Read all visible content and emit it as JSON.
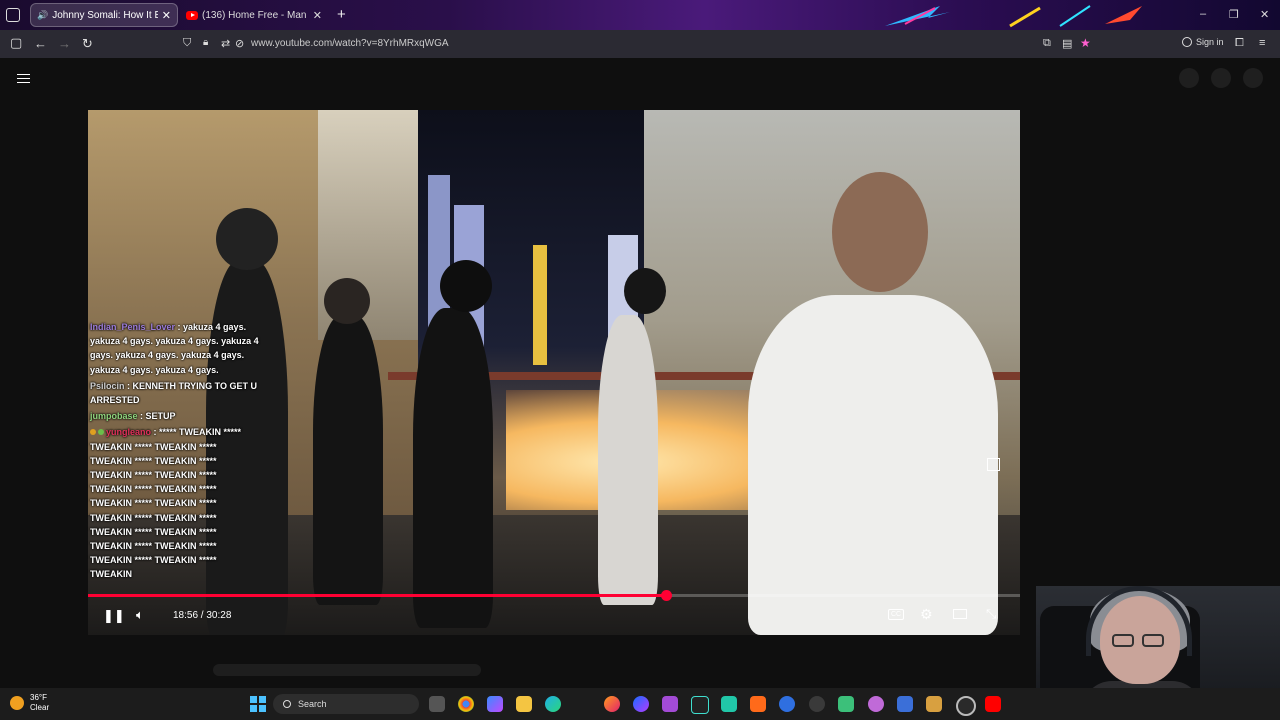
{
  "browser": {
    "tabs": [
      {
        "title": "Johnny Somali: How It Ende",
        "active": true,
        "audio": true
      },
      {
        "title": "(136) Home Free - Man of Con",
        "active": false,
        "audio": false
      }
    ],
    "new_tab": "+",
    "url": "www.youtube.com/watch?v=8YrhMRxqWGA",
    "sign_in": "Sign in",
    "window_controls": [
      "–",
      "❐",
      "✕"
    ],
    "nav_icons": [
      "sidebar-icon",
      "back-icon",
      "forward-icon",
      "reload-icon"
    ]
  },
  "youtube": {
    "menu_icon": "hamburger-icon"
  },
  "video": {
    "chat": [
      {
        "user": "Indian_Penis_Lover",
        "color": "#9b7bd9",
        "text": " : yakuza 4 gays. yakuza 4 gays. yakuza 4 gays. yakuza 4 gays. yakuza 4 gays. yakuza 4 gays. yakuza 4 gays. yakuza 4 gays."
      },
      {
        "user": "Psilocin",
        "color": "#cfcfcf",
        "text": " : KENNETH TRYING TO GET U ARRESTED"
      },
      {
        "user": "jumpobase",
        "color": "#8fd47d",
        "text": " : SETUP"
      },
      {
        "user": "yungleano",
        "color": "#e0305a",
        "text": " : ***** TWEAKIN ***** TWEAKIN ***** TWEAKIN ***** TWEAKIN ***** TWEAKIN ***** TWEAKIN ***** TWEAKIN ***** TWEAKIN ***** TWEAKIN ***** TWEAKIN ***** TWEAKIN ***** TWEAKIN ***** TWEAKIN ***** TWEAKIN ***** TWEAKIN ***** TWEAKIN ***** TWEAKIN ***** TWEAKIN ***** TWEAKIN ***** TWEAKIN"
      }
    ],
    "time_current": "18:56",
    "time_separator": " / ",
    "time_total": "30:28",
    "progress": 0.62,
    "accent_color": "#ff0033"
  },
  "taskbar": {
    "weather_temp": "36°F",
    "weather_desc": "Clear",
    "search_label": "Search",
    "apps": [
      "files-icon",
      "chrome-icon",
      "copilot-icon",
      "folder-icon",
      "edge-icon",
      "firefox-icon",
      "messenger-icon",
      "app-p-icon",
      "waveform-icon",
      "discord-icon",
      "brave-icon",
      "copilot2-icon",
      "steam-icon",
      "ai-icon",
      "game-icon",
      "notepad-icon",
      "character-icon",
      "obs-icon",
      "youtube-icon"
    ]
  }
}
